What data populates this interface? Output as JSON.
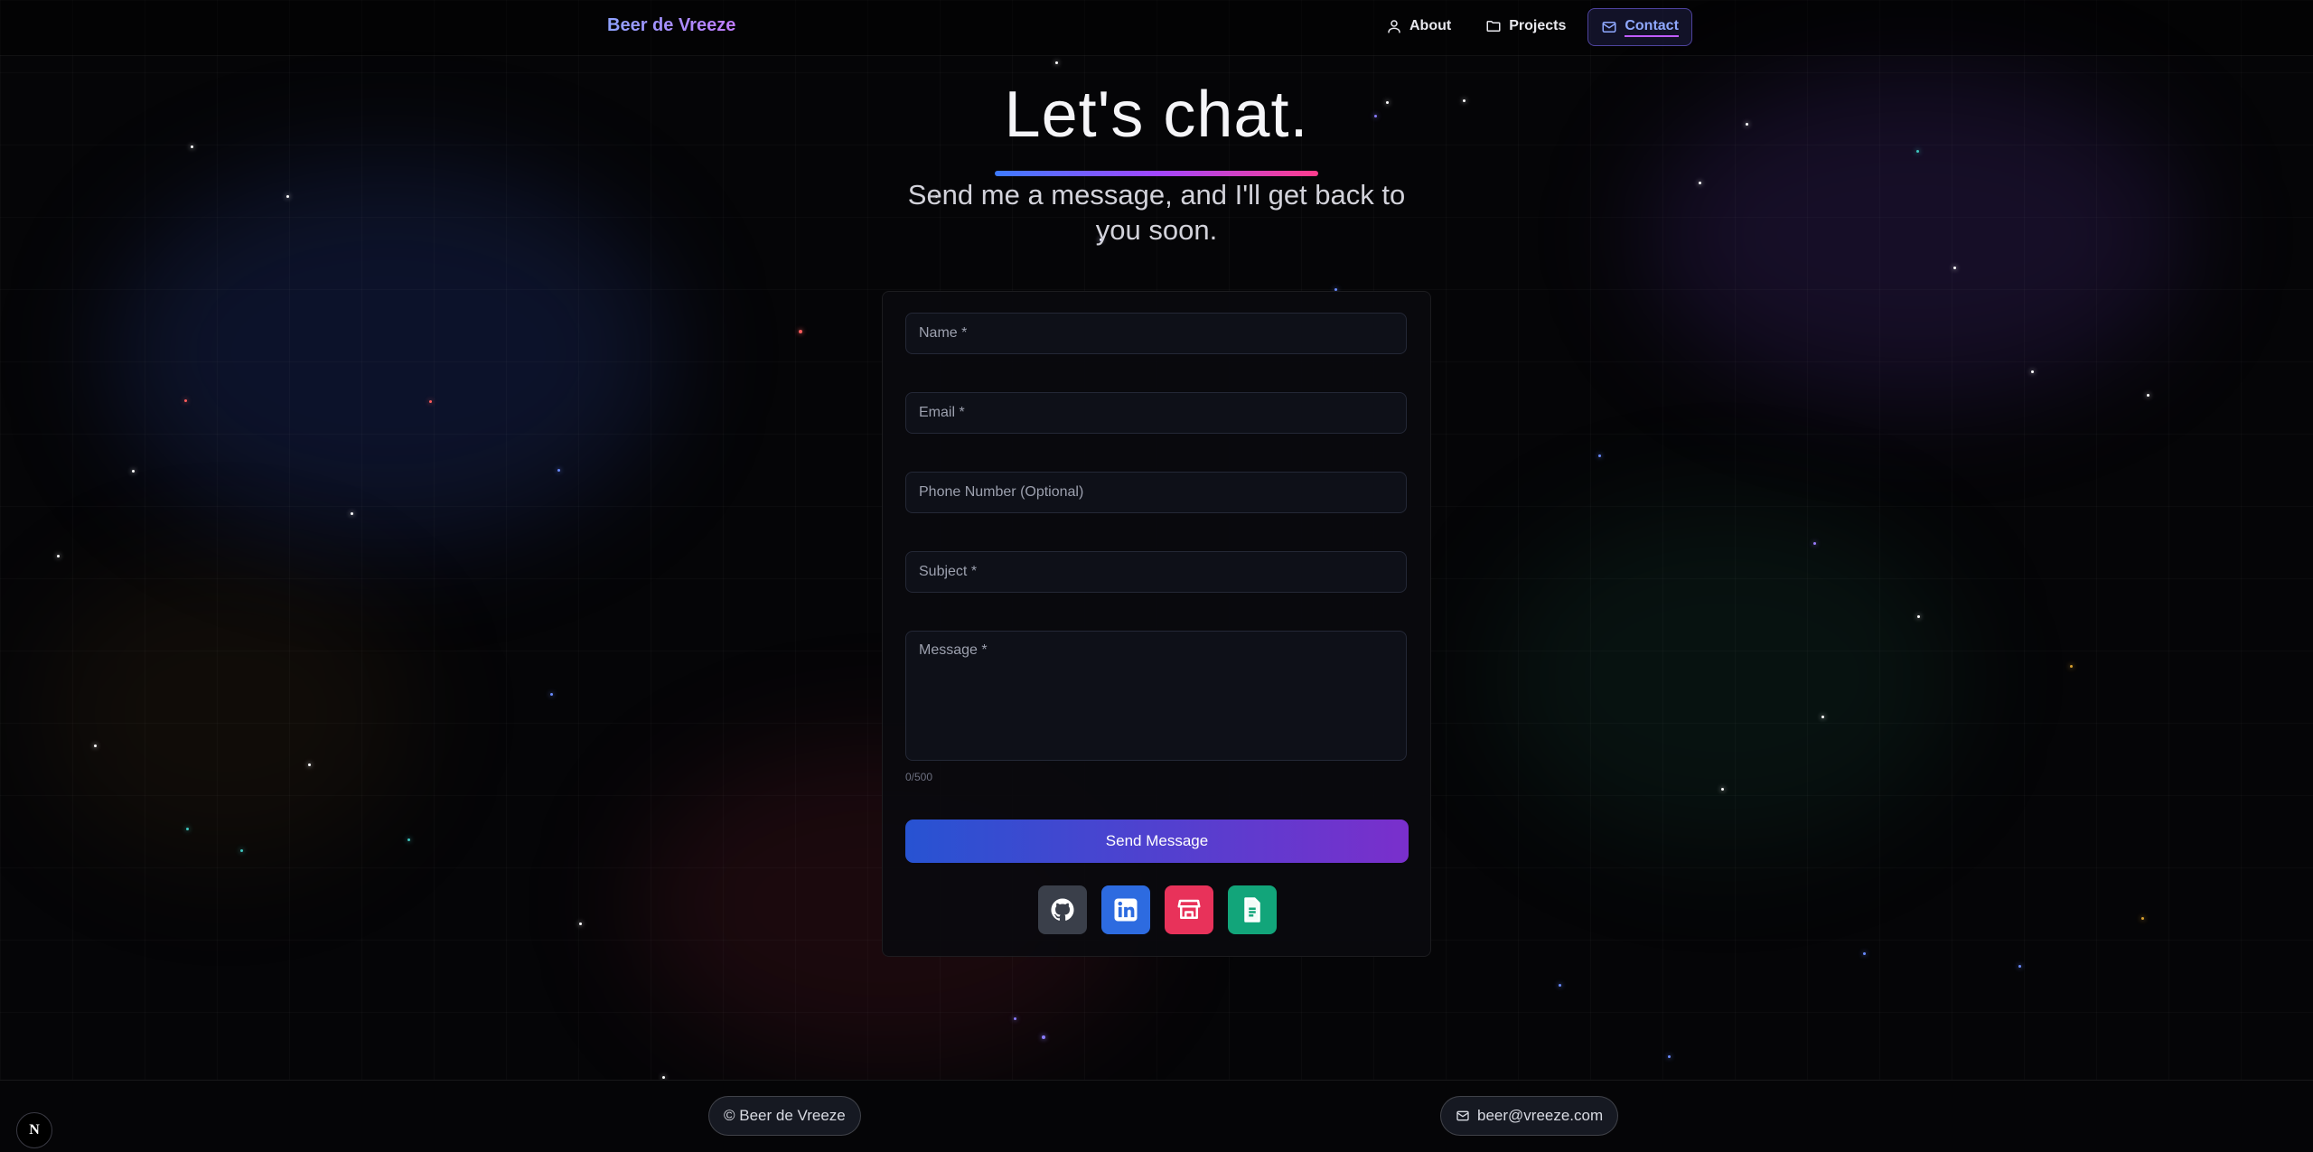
{
  "header": {
    "brand": "Beer de Vreeze",
    "nav": [
      {
        "label": "About",
        "icon": "user-icon",
        "active": false
      },
      {
        "label": "Projects",
        "icon": "folder-icon",
        "active": false
      },
      {
        "label": "Contact",
        "icon": "mail-icon",
        "active": true
      }
    ]
  },
  "hero": {
    "title": "Let's chat.",
    "subtitle": "Send me a message, and I'll get back to you soon."
  },
  "form": {
    "name_placeholder": "Name *",
    "email_placeholder": "Email *",
    "phone_placeholder": "Phone Number (Optional)",
    "subject_placeholder": "Subject *",
    "message_placeholder": "Message *",
    "char_counter": "0/500",
    "submit_label": "Send Message"
  },
  "socials": [
    {
      "icon": "github-icon",
      "color": "#3a3f4a"
    },
    {
      "icon": "linkedin-icon",
      "color": "#2d6be0"
    },
    {
      "icon": "store-icon",
      "color": "#e8325a"
    },
    {
      "icon": "document-icon",
      "color": "#12a57a"
    }
  ],
  "footer": {
    "copyright": "© Beer de Vreeze",
    "email": "beer@vreeze.com"
  },
  "dev_badge": "N",
  "colors": {
    "accent_blue": "#3d7bff",
    "accent_purple": "#a146ff",
    "accent_pink": "#ff3c8c",
    "background": "#050507"
  }
}
